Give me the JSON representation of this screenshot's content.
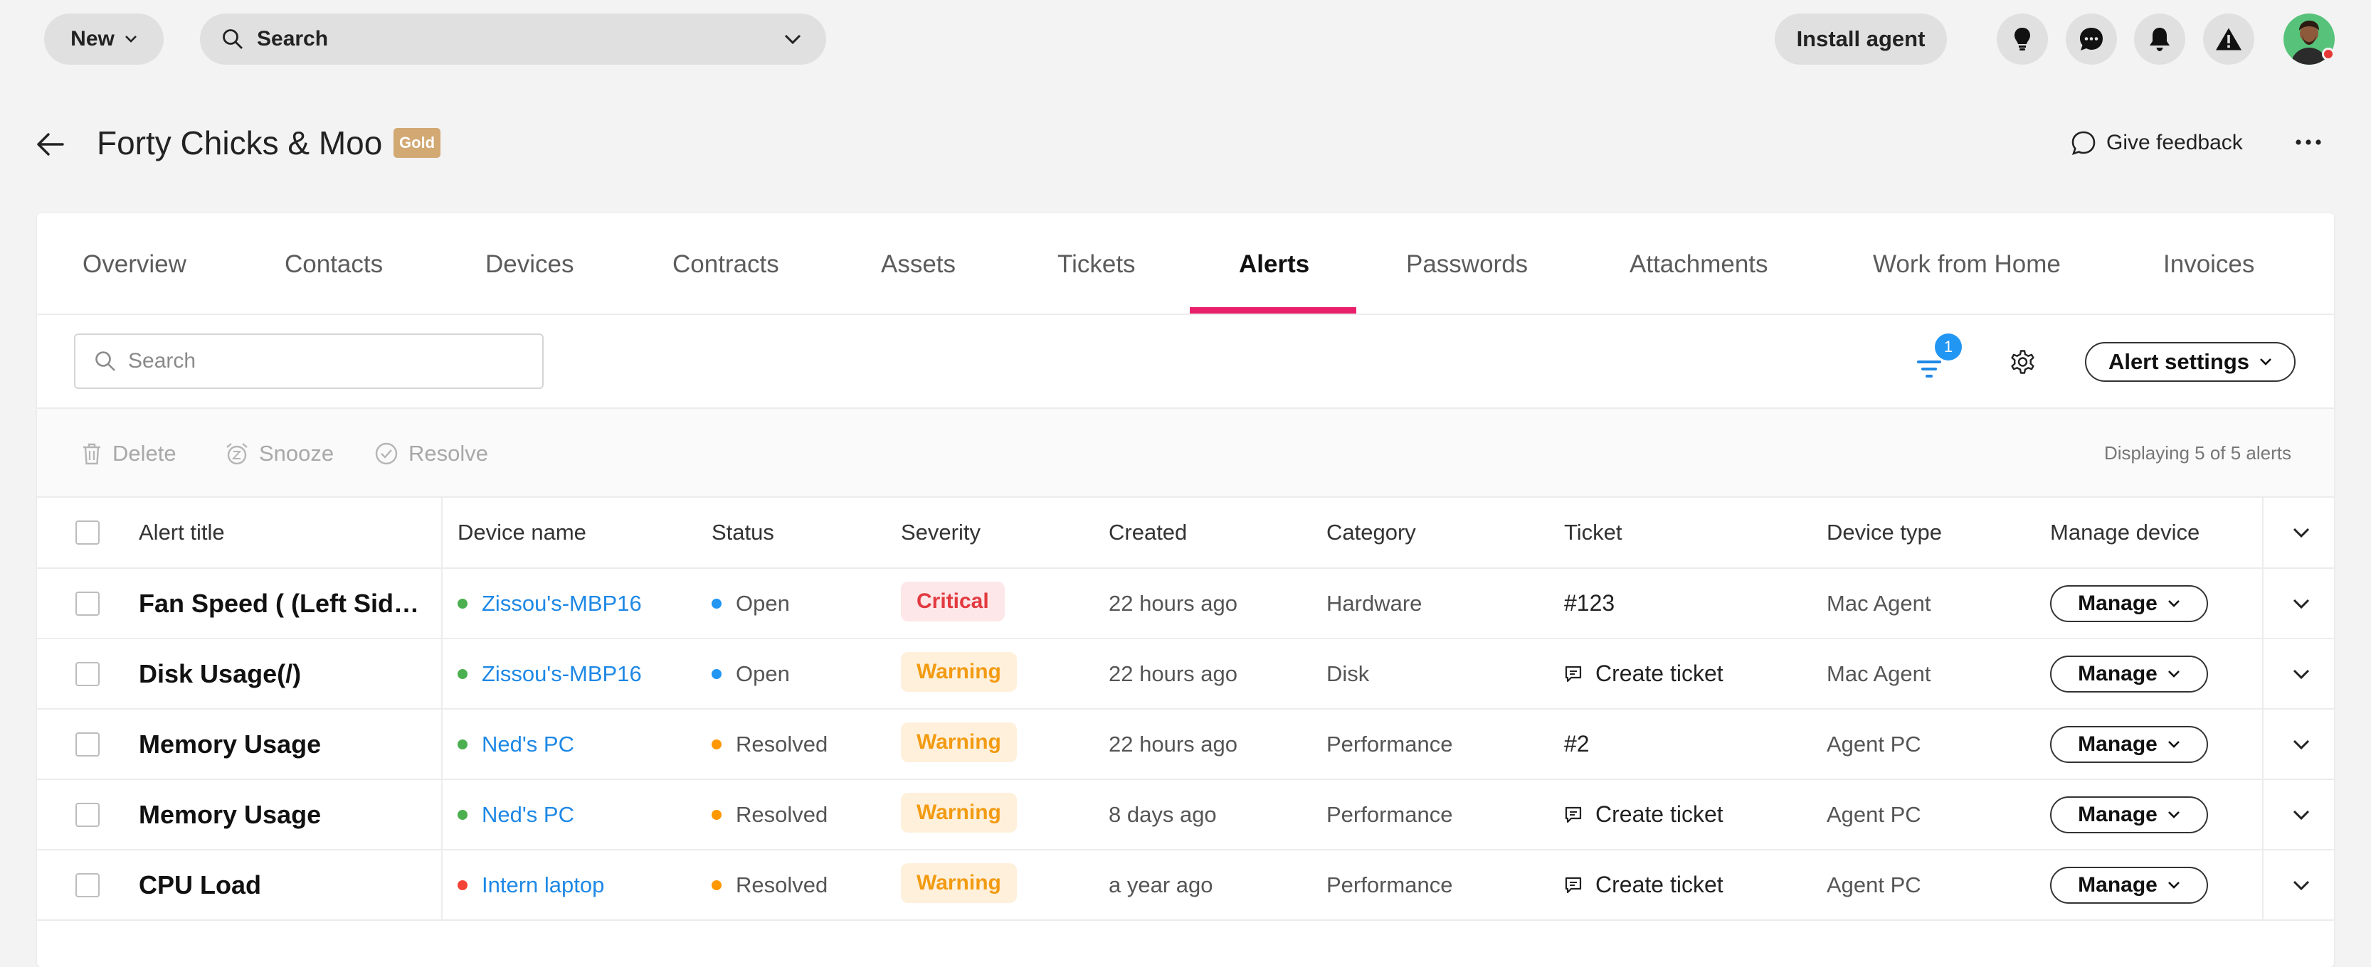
{
  "topbar": {
    "new_label": "New",
    "search_label": "Search",
    "install_agent_label": "Install agent",
    "icons": [
      "lightbulb-icon",
      "chat-icon",
      "bell-icon",
      "warning-icon"
    ]
  },
  "header": {
    "title": "Forty Chicks & Moo",
    "tier": "Gold",
    "feedback_label": "Give feedback"
  },
  "tabs": [
    {
      "label": "Overview",
      "active": false
    },
    {
      "label": "Contacts",
      "active": false
    },
    {
      "label": "Devices",
      "active": false
    },
    {
      "label": "Contracts",
      "active": false
    },
    {
      "label": "Assets",
      "active": false
    },
    {
      "label": "Tickets",
      "active": false
    },
    {
      "label": "Alerts",
      "active": true
    },
    {
      "label": "Passwords",
      "active": false
    },
    {
      "label": "Attachments",
      "active": false
    },
    {
      "label": "Work from Home",
      "active": false
    },
    {
      "label": "Invoices",
      "active": false
    }
  ],
  "toolbar": {
    "search_placeholder": "Search",
    "filter_count": "1",
    "alert_settings_label": "Alert settings"
  },
  "actions": {
    "delete_label": "Delete",
    "snooze_label": "Snooze",
    "resolve_label": "Resolve",
    "display_count": "Displaying 5 of 5 alerts"
  },
  "table": {
    "columns": [
      "Alert title",
      "Device name",
      "Status",
      "Severity",
      "Created",
      "Category",
      "Ticket",
      "Device type",
      "Manage device"
    ],
    "manage_label": "Manage",
    "rows": [
      {
        "title": "Fan Speed ( (Left Side) Fan Speed )",
        "device": "Zissou's-MBP16",
        "device_status": "online",
        "status": "Open",
        "severity": "Critical",
        "created": "22 hours ago",
        "category": "Hardware",
        "ticket": "#123",
        "ticket_type": "number",
        "device_type": "Mac Agent"
      },
      {
        "title": "Disk Usage(/)",
        "device": "Zissou's-MBP16",
        "device_status": "online",
        "status": "Open",
        "severity": "Warning",
        "created": "22 hours ago",
        "category": "Disk",
        "ticket": "Create ticket",
        "ticket_type": "create",
        "device_type": "Mac Agent"
      },
      {
        "title": "Memory Usage",
        "device": "Ned's PC",
        "device_status": "online",
        "status": "Resolved",
        "severity": "Warning",
        "created": "22 hours ago",
        "category": "Performance",
        "ticket": "#2",
        "ticket_type": "number",
        "device_type": "Agent PC"
      },
      {
        "title": "Memory Usage",
        "device": "Ned's PC",
        "device_status": "online",
        "status": "Resolved",
        "severity": "Warning",
        "created": "8 days ago",
        "category": "Performance",
        "ticket": "Create ticket",
        "ticket_type": "create",
        "device_type": "Agent PC"
      },
      {
        "title": "CPU Load",
        "device": "Intern laptop",
        "device_status": "offline",
        "status": "Resolved",
        "severity": "Warning",
        "created": "a year ago",
        "category": "Performance",
        "ticket": "Create ticket",
        "ticket_type": "create",
        "device_type": "Agent PC"
      }
    ]
  },
  "colors": {
    "accent": "#ea1f6c",
    "link": "#1e88e5",
    "online": "#4caf50",
    "offline": "#f44336",
    "status_open": "#2196f3",
    "status_resolved": "#ff9800",
    "tier_gold": "#d2a873"
  }
}
